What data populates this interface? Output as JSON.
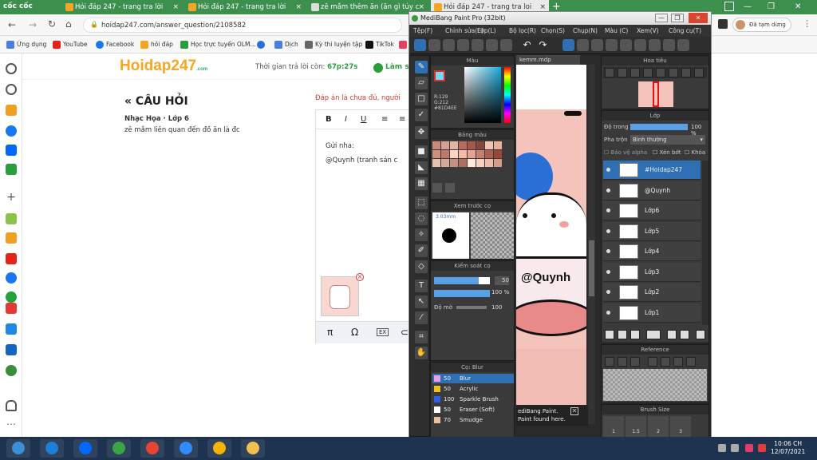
{
  "browser": {
    "brand": "cốc cốc",
    "tabs": [
      {
        "label": "Hỏi đáp 247 - trang tra lời",
        "close": "×"
      },
      {
        "label": "Hỏi đáp 247 - trang tra lời",
        "close": "×"
      },
      {
        "label": "zê mầm thêm ăn (ăn gì túy c",
        "close": "×"
      },
      {
        "label": "Hỏi đáp 247 - trang tra loi",
        "close": "×"
      }
    ],
    "new_tab": "+",
    "url": "hoidap247.com/answer_question/2108582",
    "profile_label": "Đã tạm dừng",
    "window_controls": [
      "—",
      "❐",
      "✕"
    ],
    "bookmarks": [
      {
        "label": "Ứng dụng",
        "color": "#4a7ee0"
      },
      {
        "label": "YouTube",
        "color": "#e62117"
      },
      {
        "label": "Facebook",
        "color": "#1877f2"
      },
      {
        "label": "hỏi đáp",
        "color": "#f5a623"
      },
      {
        "label": "Học trực tuyến OLM...",
        "color": "#2a9d3c"
      },
      {
        "label": "",
        "color": "#2a6fdb"
      },
      {
        "label": "Dịch",
        "color": "#4a7ee0"
      },
      {
        "label": "Kỳ thi luyện tập",
        "color": "#666"
      },
      {
        "label": "TikTok",
        "color": "#111"
      },
      {
        "label": "",
        "color": "#e4405f"
      },
      {
        "label": "",
        "color": "#1877f2"
      }
    ]
  },
  "site": {
    "logo": "Hoidap247",
    "logo_sub": ".com",
    "timer_label": "Thời gian trả lời còn:",
    "timer_value": "67p:27s",
    "answer_tab": "Làm s",
    "heading": "« CÂU HỎI",
    "subject": "Nhạc Họa · Lớp 6",
    "question": "zê mầm liên quan đến đồ ăn là đc",
    "answer_notice": "Đáp án là chưa đủ, người",
    "editor_text_1": "Gửi nha:",
    "editor_text_2": "@Quynh   (tranh sản c",
    "editor_buttons": [
      "B",
      "I",
      "U",
      "≡",
      "≡"
    ],
    "bottom_buttons": [
      "π",
      "Ω",
      "EX",
      "⊂"
    ]
  },
  "medibang": {
    "title": "MediBang Paint Pro (32bit)",
    "menu": [
      "Tệp(F)",
      "Chỉnh sửa(E)",
      "Lớp(L)",
      "Bộ lọc(R)",
      "Chọn(S)",
      "Chụp(N)",
      "Màu (C)",
      "Xem(V)",
      "Công cụ(T)"
    ],
    "color_panel": {
      "title": "Màu",
      "r": "R:129",
      "g": "G:212",
      "hex": "#81D4EE"
    },
    "palette_title": "Bảng màu",
    "palette_colors": [
      "#c98a78",
      "#d8a090",
      "#e3b5a3",
      "#b86b5a",
      "#a4584a",
      "#8a463a",
      "#f0c4b2",
      "#e8b09a",
      "#d09080",
      "#c07868",
      "#ffd6c4",
      "#f4baa6",
      "#e6a290",
      "#c68070",
      "#aa6050",
      "#934838",
      "#e8c0b0",
      "#d8a898",
      "#c89080",
      "#b07060",
      "#ffe8dc",
      "#f8d0c0",
      "#ecbca8",
      "#d49c88"
    ],
    "preview_title": "Xem trước cọ",
    "preview_size": "3.03mm",
    "brush_ctrl_title": "Kiểm soát cọ",
    "brush_size": "50",
    "brush_opacity": "100 %",
    "density_label": "Độ mờ",
    "density_value": "100",
    "brush_title": "Cọ: Blur",
    "brushes": [
      {
        "size": "50",
        "name": "Blur",
        "color": "#e6a0e6",
        "selected": true
      },
      {
        "size": "50",
        "name": "Acrylic",
        "color": "#f0c020",
        "selected": false
      },
      {
        "size": "100",
        "name": "Sparkle Brush",
        "color": "#3060e0",
        "selected": false
      },
      {
        "size": "50",
        "name": "Eraser (Soft)",
        "color": "#ffffff",
        "selected": false
      },
      {
        "size": "70",
        "name": "Smudge",
        "color": "#e8c0a0",
        "selected": false
      }
    ],
    "canvas_tab": "kemm.mdp",
    "canvas_text": "@Quynh",
    "toast_1": "ediBang Paint.",
    "toast_2": "Paint found here.",
    "nav_title": "Hoa tiêu",
    "layer_title": "Lớp",
    "opacity_label": "Độ trong",
    "opacity_value": "100 %",
    "blend_label": "Pha trộn",
    "blend_value": "Bình thường",
    "protect_alpha": "Bảo vệ alpha",
    "clipping": "Xén bớt",
    "lock": "Khóa",
    "layers": [
      {
        "name": "#Hoidap247",
        "selected": true
      },
      {
        "name": "@Quynh",
        "selected": false
      },
      {
        "name": "Lớp6",
        "selected": false
      },
      {
        "name": "Lớp5",
        "selected": false
      },
      {
        "name": "Lớp4",
        "selected": false
      },
      {
        "name": "Lớp3",
        "selected": false
      },
      {
        "name": "Lớp2",
        "selected": false
      },
      {
        "name": "Lớp1",
        "selected": false
      }
    ],
    "reference_title": "Reference",
    "brush_size_title": "Brush Size",
    "brush_size_values": [
      "1",
      "1.5",
      "2",
      "3"
    ]
  },
  "taskbar": {
    "time": "10:06 CH",
    "date": "12/07/2021",
    "apps": [
      {
        "name": "start",
        "color": "#3a8fd8"
      },
      {
        "name": "ie",
        "color": "#1e7fd6"
      },
      {
        "name": "zalo",
        "color": "#0068ff"
      },
      {
        "name": "coccoc",
        "color": "#3aa547"
      },
      {
        "name": "chrome",
        "color": "#e94335"
      },
      {
        "name": "zoom",
        "color": "#2d8cff"
      },
      {
        "name": "paint",
        "color": "#f5b400"
      },
      {
        "name": "explorer",
        "color": "#f0c050"
      }
    ]
  },
  "colors": {
    "coccoc_green": "#3c8f4d",
    "hoidap_orange": "#f5a623",
    "medibang_blue": "#2f6fb3",
    "canvas_pink": "#f4c4bc"
  }
}
